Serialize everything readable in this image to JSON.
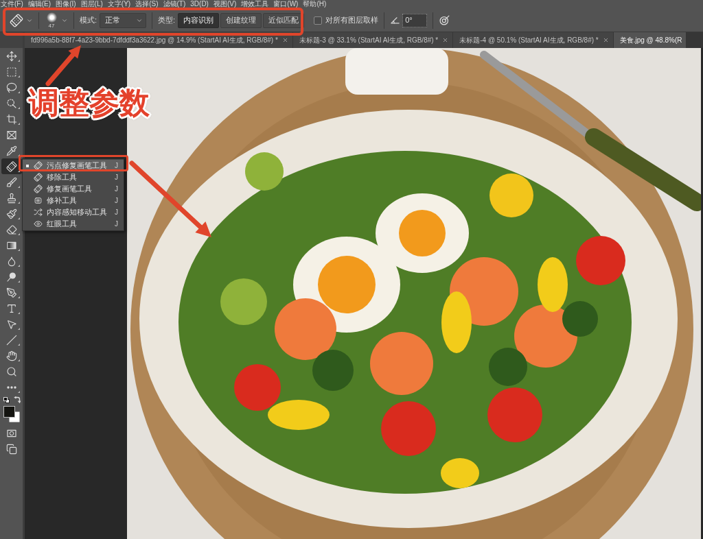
{
  "menu_bar": {
    "items": [
      "文件(F)",
      "编辑(E)",
      "图像(I)",
      "图层(L)",
      "文字(Y)",
      "选择(S)",
      "滤镜(T)",
      "3D(D)",
      "视图(V)",
      "增效工具",
      "窗口(W)",
      "帮助(H)"
    ]
  },
  "options_bar": {
    "brush_size": "47",
    "mode": {
      "label": "模式:",
      "value": "正常"
    },
    "type": {
      "label": "类型:",
      "options": [
        {
          "label": "内容识别",
          "selected": true
        },
        {
          "label": "创建纹理",
          "selected": false
        },
        {
          "label": "近似匹配",
          "selected": false
        }
      ]
    },
    "sample_all_layers": {
      "label": "对所有图层取样",
      "checked": false
    },
    "angle": {
      "value": "0°"
    }
  },
  "tabs": [
    {
      "title": "fd996a5b-88f7-4a23-9bbd-7dfddf3a3622.jpg @ 14.9% (StartAI AI生成, RGB/8#) *",
      "selected": false,
      "closable": true
    },
    {
      "title": "未标题-3 @ 33.1% (StartAI AI生成, RGB/8#) *",
      "selected": false,
      "closable": true
    },
    {
      "title": "未标题-4 @ 50.1% (StartAI AI生成, RGB/8#) *",
      "selected": false,
      "closable": true
    },
    {
      "title": "美食.jpg @ 48.8%(R",
      "selected": true,
      "closable": false
    }
  ],
  "toolbar": {
    "tools": [
      {
        "kind": "move",
        "selected": false
      },
      {
        "kind": "marquee",
        "selected": false
      },
      {
        "kind": "lasso",
        "selected": false
      },
      {
        "kind": "quick-select",
        "selected": false
      },
      {
        "kind": "crop",
        "selected": false
      },
      {
        "kind": "frame",
        "selected": false
      },
      {
        "kind": "eyedropper",
        "selected": false
      },
      {
        "kind": "spot-healing",
        "selected": true
      },
      {
        "kind": "brush",
        "selected": false
      },
      {
        "kind": "stamp",
        "selected": false
      },
      {
        "kind": "history-brush",
        "selected": false
      },
      {
        "kind": "eraser",
        "selected": false
      },
      {
        "kind": "gradient",
        "selected": false
      },
      {
        "kind": "blur",
        "selected": false
      },
      {
        "kind": "dodge",
        "selected": false
      },
      {
        "kind": "pen",
        "selected": false
      },
      {
        "kind": "type",
        "selected": false
      },
      {
        "kind": "path-select",
        "selected": false
      },
      {
        "kind": "line",
        "selected": false
      },
      {
        "kind": "hand",
        "selected": false
      },
      {
        "kind": "zoom",
        "selected": false
      },
      {
        "kind": "more",
        "selected": false
      }
    ]
  },
  "tool_flyout": {
    "items": [
      {
        "kind": "spot-healing",
        "label": "污点修复画笔工具",
        "shortcut": "J",
        "selected": true
      },
      {
        "kind": "remove",
        "label": "移除工具",
        "shortcut": "J",
        "selected": false
      },
      {
        "kind": "healing-brush",
        "label": "修复画笔工具",
        "shortcut": "J",
        "selected": false
      },
      {
        "kind": "patch",
        "label": "修补工具",
        "shortcut": "J",
        "selected": false
      },
      {
        "kind": "content-aware-move",
        "label": "内容感知移动工具",
        "shortcut": "J",
        "selected": false
      },
      {
        "kind": "red-eye",
        "label": "红眼工具",
        "shortcut": "J",
        "selected": false
      }
    ]
  },
  "annotation": {
    "callout": "调整参数"
  }
}
